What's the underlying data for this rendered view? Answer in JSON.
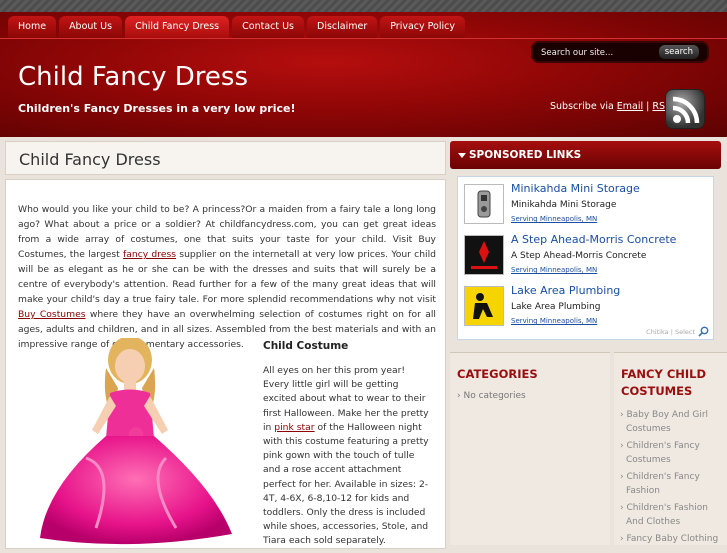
{
  "nav": [
    "Home",
    "About Us",
    "Child Fancy Dress",
    "Contact Us",
    "Disclaimer",
    "Privacy Policy"
  ],
  "search": {
    "placeholder": "Search our site...",
    "button": "search"
  },
  "site": {
    "title": "Child Fancy Dress",
    "tagline": "Children's Fancy Dresses in a very low price!"
  },
  "subscribe": {
    "prefix": "Subscribe via ",
    "email": "Email",
    "sep": " | ",
    "rss": "RSS"
  },
  "page": {
    "title": "Child Fancy Dress"
  },
  "intro": {
    "p1": "Who would you like your child to be? A princess?Or a maiden from a fairy tale a long long ago? What about a price or a soldier? At childfancydress.com, you can get great ideas from a wide array of costumes, one that suits your taste for your child.  Visit Buy Costumes, the largest ",
    "link1": "fancy dress",
    "p2": " supplier on the internetall at very low prices. Your child will be as elegant as he or she can be with the dresses and suits that will surely be a centre of everybody's attention.  Read further for a few of the many great ideas that will make your child's day a true fairy tale. For more splendid recommendations why not visit ",
    "link2": "Buy Costumes",
    "p3": " where they have an overwhelming selection of costumes right on for all ages, adults and children, and in all sizes.  Assembled from the best materials and with an impressive range of complementary accessories."
  },
  "costume": {
    "heading": "Child Costume",
    "p1": "All eyes on her this prom year!  Every little girl will be getting excited about what to wear to their first Halloween. Make her the pretty in ",
    "link": "pink star",
    "p2": " of the Halloween night with this costume featuring a pretty pink gown with the touch of tulle and a rose accent attachment perfect for her. Available in sizes: 2-4T, 4-6X, 6-8,10-12 for kids and toddlers.  Only the dress is included while shoes, accessories, Stole, and Tiara each sold separately."
  },
  "sponsored": {
    "heading": "SPONSORED LINKS",
    "ads": [
      {
        "title": "Minikahda Mini Storage",
        "desc": "Minikahda Mini Storage",
        "loc": "Serving Minneapolis, MN"
      },
      {
        "title": "A Step Ahead-Morris Concrete",
        "desc": "A Step Ahead-Morris Concrete",
        "loc": "Serving Minneapolis, MN"
      },
      {
        "title": "Lake Area Plumbing",
        "desc": "Lake Area Plumbing",
        "loc": "Serving Minneapolis, MN"
      }
    ],
    "footer": "Chitika | Select"
  },
  "categories": {
    "heading": "CATEGORIES",
    "item": "No categories"
  },
  "fancy": {
    "heading": "FANCY CHILD COSTUMES",
    "items": [
      "Baby Boy And Girl Costumes",
      "Children's Fancy Costumes",
      "Children's Fancy Fashion",
      "Children's Fashion And Clothes",
      "Fancy Baby Clothing"
    ]
  },
  "colors": {
    "header": "#8f0606",
    "accent": "#9a0d0d",
    "link": "#1a4ea0"
  }
}
